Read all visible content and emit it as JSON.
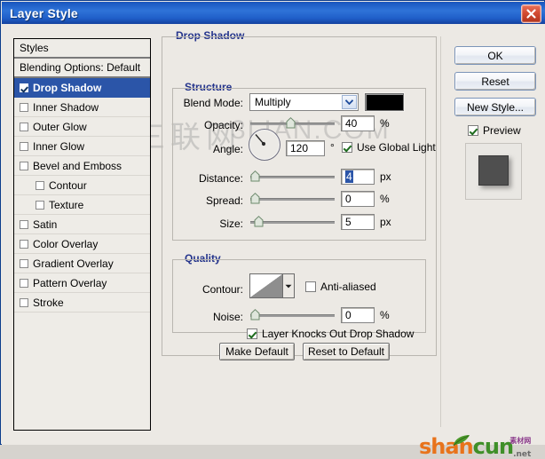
{
  "window": {
    "title": "Layer Style",
    "close_icon": "close-icon"
  },
  "styles_list": {
    "header": "Styles",
    "blending_options": "Blending Options: Default",
    "items": [
      {
        "label": "Drop Shadow",
        "checked": true,
        "selected": true,
        "sub": false
      },
      {
        "label": "Inner Shadow",
        "checked": false,
        "selected": false,
        "sub": false
      },
      {
        "label": "Outer Glow",
        "checked": false,
        "selected": false,
        "sub": false
      },
      {
        "label": "Inner Glow",
        "checked": false,
        "selected": false,
        "sub": false
      },
      {
        "label": "Bevel and Emboss",
        "checked": false,
        "selected": false,
        "sub": false
      },
      {
        "label": "Contour",
        "checked": false,
        "selected": false,
        "sub": true
      },
      {
        "label": "Texture",
        "checked": false,
        "selected": false,
        "sub": true
      },
      {
        "label": "Satin",
        "checked": false,
        "selected": false,
        "sub": false
      },
      {
        "label": "Color Overlay",
        "checked": false,
        "selected": false,
        "sub": false
      },
      {
        "label": "Gradient Overlay",
        "checked": false,
        "selected": false,
        "sub": false
      },
      {
        "label": "Pattern Overlay",
        "checked": false,
        "selected": false,
        "sub": false
      },
      {
        "label": "Stroke",
        "checked": false,
        "selected": false,
        "sub": false
      }
    ]
  },
  "panel": {
    "title": "Drop Shadow",
    "structure": {
      "title": "Structure",
      "blend_mode_label": "Blend Mode:",
      "blend_mode_value": "Multiply",
      "shadow_color": "#000000",
      "opacity_label": "Opacity:",
      "opacity_value": "40",
      "opacity_unit": "%",
      "angle_label": "Angle:",
      "angle_value": "120",
      "angle_unit": "°",
      "use_global_light_label": "Use Global Light",
      "use_global_light_checked": true,
      "distance_label": "Distance:",
      "distance_value": "4",
      "distance_unit": "px",
      "spread_label": "Spread:",
      "spread_value": "0",
      "spread_unit": "%",
      "size_label": "Size:",
      "size_value": "5",
      "size_unit": "px"
    },
    "quality": {
      "title": "Quality",
      "contour_label": "Contour:",
      "anti_aliased_label": "Anti-aliased",
      "anti_aliased_checked": false,
      "noise_label": "Noise:",
      "noise_value": "0",
      "noise_unit": "%"
    },
    "knockout_label": "Layer Knocks Out Drop Shadow",
    "knockout_checked": true,
    "make_default_label": "Make Default",
    "reset_to_default_label": "Reset to Default"
  },
  "actions": {
    "ok_label": "OK",
    "reset_label": "Reset",
    "new_style_label": "New Style...",
    "preview_label": "Preview",
    "preview_checked": true
  },
  "watermarks": {
    "cjk": "三联网",
    "latin": "3LIAN.COM",
    "logo_first": "shan",
    "logo_second": "cun",
    "logo_tld": ".net",
    "logo_cjk": "素材网"
  },
  "colors": {
    "titlebar_blue": "#1d5cc4",
    "selection_blue": "#2b55a8",
    "section_heading": "#24348c",
    "dialog_face": "#ece9e4"
  }
}
